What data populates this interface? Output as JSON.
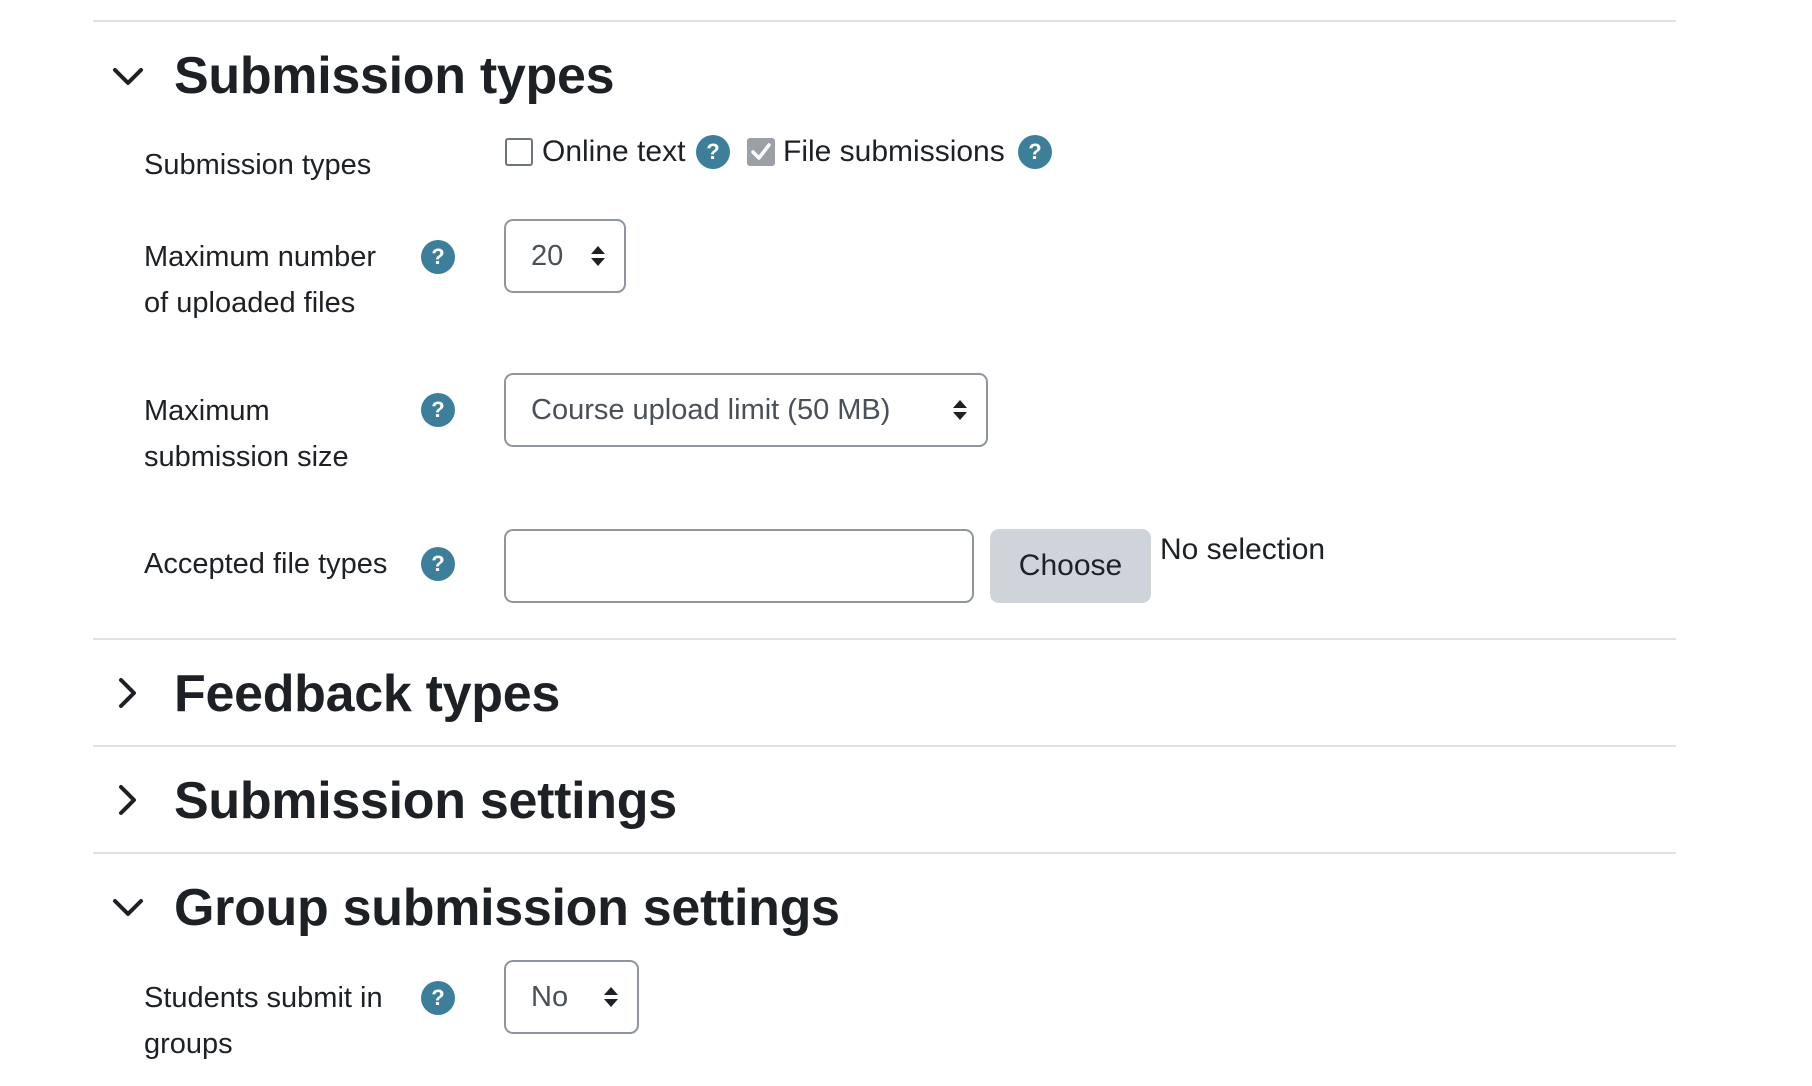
{
  "sections": {
    "submission_types": {
      "title": "Submission types",
      "state": "expanded",
      "fields": {
        "submission_types_label": "Submission types",
        "online_text": {
          "label": "Online text",
          "checked": false
        },
        "file_submissions": {
          "label": "File submissions",
          "checked": true
        },
        "max_files": {
          "label_line1": "Maximum number",
          "label_line2": "of uploaded files",
          "value": "20"
        },
        "max_size": {
          "label_line1": "Maximum",
          "label_line2": "submission size",
          "value": "Course upload limit (50 MB)"
        },
        "accepted_types": {
          "label": "Accepted file types",
          "input_value": "",
          "button_label": "Choose",
          "status": "No selection"
        }
      }
    },
    "feedback_types": {
      "title": "Feedback types",
      "state": "collapsed"
    },
    "submission_settings": {
      "title": "Submission settings",
      "state": "collapsed"
    },
    "group_submission_settings": {
      "title": "Group submission settings",
      "state": "expanded",
      "fields": {
        "students_submit_in_groups": {
          "label_line1": "Students submit in",
          "label_line2": "groups",
          "value": "No"
        }
      }
    }
  },
  "help_icon_text": "?",
  "colors": {
    "text": "#1d2125",
    "help_icon": "#3d7f9b",
    "divider": "#dee2e6",
    "button": "#ced4da",
    "border": "#8f959e"
  },
  "icons": {
    "expanded": "chevron-down-icon",
    "collapsed": "chevron-right-icon",
    "help": "question-circle-icon",
    "select": "sort-arrows-icon"
  }
}
